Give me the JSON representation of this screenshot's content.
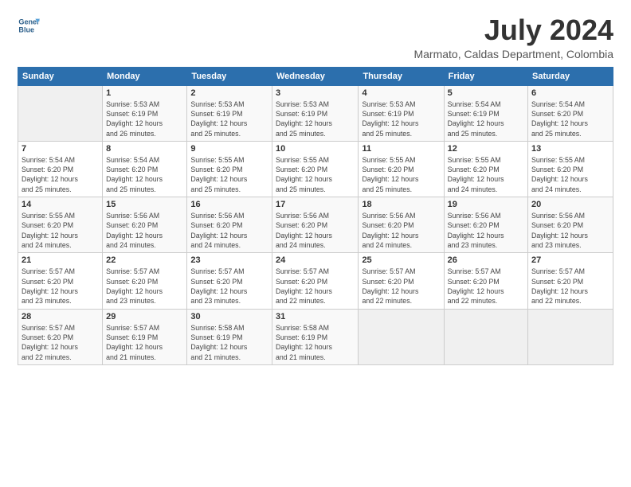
{
  "logo": {
    "line1": "General",
    "line2": "Blue"
  },
  "title": "July 2024",
  "subtitle": "Marmato, Caldas Department, Colombia",
  "days_header": [
    "Sunday",
    "Monday",
    "Tuesday",
    "Wednesday",
    "Thursday",
    "Friday",
    "Saturday"
  ],
  "weeks": [
    [
      {
        "num": "",
        "info": ""
      },
      {
        "num": "1",
        "info": "Sunrise: 5:53 AM\nSunset: 6:19 PM\nDaylight: 12 hours\nand 26 minutes."
      },
      {
        "num": "2",
        "info": "Sunrise: 5:53 AM\nSunset: 6:19 PM\nDaylight: 12 hours\nand 25 minutes."
      },
      {
        "num": "3",
        "info": "Sunrise: 5:53 AM\nSunset: 6:19 PM\nDaylight: 12 hours\nand 25 minutes."
      },
      {
        "num": "4",
        "info": "Sunrise: 5:53 AM\nSunset: 6:19 PM\nDaylight: 12 hours\nand 25 minutes."
      },
      {
        "num": "5",
        "info": "Sunrise: 5:54 AM\nSunset: 6:19 PM\nDaylight: 12 hours\nand 25 minutes."
      },
      {
        "num": "6",
        "info": "Sunrise: 5:54 AM\nSunset: 6:20 PM\nDaylight: 12 hours\nand 25 minutes."
      }
    ],
    [
      {
        "num": "7",
        "info": "Sunrise: 5:54 AM\nSunset: 6:20 PM\nDaylight: 12 hours\nand 25 minutes."
      },
      {
        "num": "8",
        "info": "Sunrise: 5:54 AM\nSunset: 6:20 PM\nDaylight: 12 hours\nand 25 minutes."
      },
      {
        "num": "9",
        "info": "Sunrise: 5:55 AM\nSunset: 6:20 PM\nDaylight: 12 hours\nand 25 minutes."
      },
      {
        "num": "10",
        "info": "Sunrise: 5:55 AM\nSunset: 6:20 PM\nDaylight: 12 hours\nand 25 minutes."
      },
      {
        "num": "11",
        "info": "Sunrise: 5:55 AM\nSunset: 6:20 PM\nDaylight: 12 hours\nand 25 minutes."
      },
      {
        "num": "12",
        "info": "Sunrise: 5:55 AM\nSunset: 6:20 PM\nDaylight: 12 hours\nand 24 minutes."
      },
      {
        "num": "13",
        "info": "Sunrise: 5:55 AM\nSunset: 6:20 PM\nDaylight: 12 hours\nand 24 minutes."
      }
    ],
    [
      {
        "num": "14",
        "info": "Sunrise: 5:55 AM\nSunset: 6:20 PM\nDaylight: 12 hours\nand 24 minutes."
      },
      {
        "num": "15",
        "info": "Sunrise: 5:56 AM\nSunset: 6:20 PM\nDaylight: 12 hours\nand 24 minutes."
      },
      {
        "num": "16",
        "info": "Sunrise: 5:56 AM\nSunset: 6:20 PM\nDaylight: 12 hours\nand 24 minutes."
      },
      {
        "num": "17",
        "info": "Sunrise: 5:56 AM\nSunset: 6:20 PM\nDaylight: 12 hours\nand 24 minutes."
      },
      {
        "num": "18",
        "info": "Sunrise: 5:56 AM\nSunset: 6:20 PM\nDaylight: 12 hours\nand 24 minutes."
      },
      {
        "num": "19",
        "info": "Sunrise: 5:56 AM\nSunset: 6:20 PM\nDaylight: 12 hours\nand 23 minutes."
      },
      {
        "num": "20",
        "info": "Sunrise: 5:56 AM\nSunset: 6:20 PM\nDaylight: 12 hours\nand 23 minutes."
      }
    ],
    [
      {
        "num": "21",
        "info": "Sunrise: 5:57 AM\nSunset: 6:20 PM\nDaylight: 12 hours\nand 23 minutes."
      },
      {
        "num": "22",
        "info": "Sunrise: 5:57 AM\nSunset: 6:20 PM\nDaylight: 12 hours\nand 23 minutes."
      },
      {
        "num": "23",
        "info": "Sunrise: 5:57 AM\nSunset: 6:20 PM\nDaylight: 12 hours\nand 23 minutes."
      },
      {
        "num": "24",
        "info": "Sunrise: 5:57 AM\nSunset: 6:20 PM\nDaylight: 12 hours\nand 22 minutes."
      },
      {
        "num": "25",
        "info": "Sunrise: 5:57 AM\nSunset: 6:20 PM\nDaylight: 12 hours\nand 22 minutes."
      },
      {
        "num": "26",
        "info": "Sunrise: 5:57 AM\nSunset: 6:20 PM\nDaylight: 12 hours\nand 22 minutes."
      },
      {
        "num": "27",
        "info": "Sunrise: 5:57 AM\nSunset: 6:20 PM\nDaylight: 12 hours\nand 22 minutes."
      }
    ],
    [
      {
        "num": "28",
        "info": "Sunrise: 5:57 AM\nSunset: 6:20 PM\nDaylight: 12 hours\nand 22 minutes."
      },
      {
        "num": "29",
        "info": "Sunrise: 5:57 AM\nSunset: 6:19 PM\nDaylight: 12 hours\nand 21 minutes."
      },
      {
        "num": "30",
        "info": "Sunrise: 5:58 AM\nSunset: 6:19 PM\nDaylight: 12 hours\nand 21 minutes."
      },
      {
        "num": "31",
        "info": "Sunrise: 5:58 AM\nSunset: 6:19 PM\nDaylight: 12 hours\nand 21 minutes."
      },
      {
        "num": "",
        "info": ""
      },
      {
        "num": "",
        "info": ""
      },
      {
        "num": "",
        "info": ""
      }
    ]
  ]
}
